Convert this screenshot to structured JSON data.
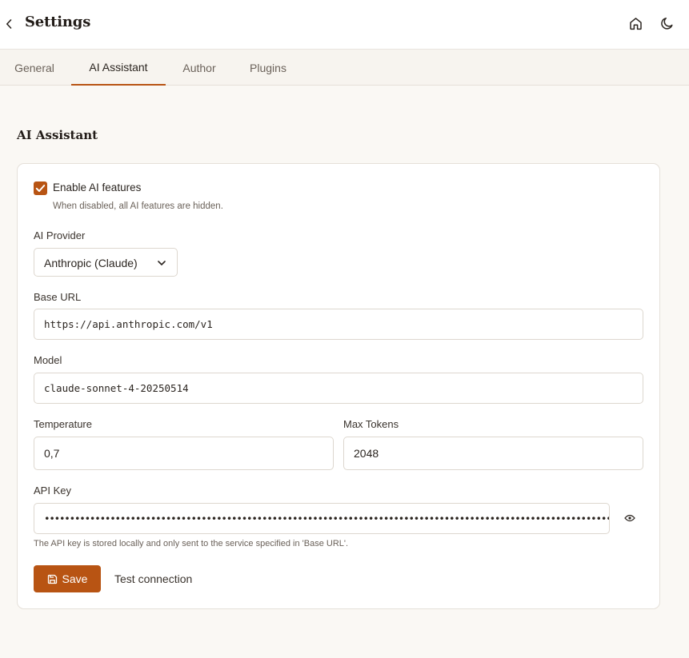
{
  "header": {
    "title": "Settings",
    "back_icon": "chevron-left-icon",
    "home_icon": "home-icon",
    "theme_icon": "moon-icon"
  },
  "tabs": [
    {
      "label": "General",
      "active": false
    },
    {
      "label": "AI Assistant",
      "active": true
    },
    {
      "label": "Author",
      "active": false
    },
    {
      "label": "Plugins",
      "active": false
    }
  ],
  "section": {
    "title": "AI Assistant"
  },
  "form": {
    "enable": {
      "label": "Enable AI features",
      "help": "When disabled, all AI features are hidden.",
      "checked": true
    },
    "provider": {
      "label": "AI Provider",
      "value": "Anthropic (Claude)"
    },
    "base_url": {
      "label": "Base URL",
      "value": "https://api.anthropic.com/v1"
    },
    "model": {
      "label": "Model",
      "value": "claude-sonnet-4-20250514"
    },
    "temperature": {
      "label": "Temperature",
      "value": "0,7"
    },
    "max_tokens": {
      "label": "Max Tokens",
      "value": "2048"
    },
    "api_key": {
      "label": "API Key",
      "value": "••••••••••••••••••••••••••••••••••••••••••••••••••••••••••••••••••••••••••••••••••••••••••••••••••••••••••••••••••••",
      "help": "The API key is stored locally and only sent to the service specified in 'Base URL'."
    },
    "save_label": "Save",
    "test_label": "Test connection"
  },
  "colors": {
    "accent": "#b85413",
    "background": "#faf8f4"
  }
}
